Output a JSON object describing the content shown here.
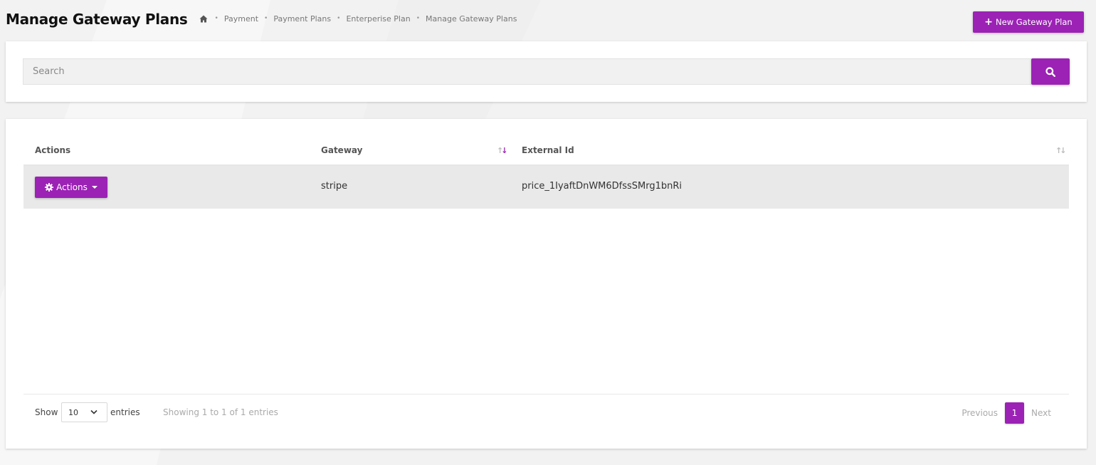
{
  "header": {
    "title": "Manage Gateway Plans",
    "new_button_label": "New Gateway Plan"
  },
  "breadcrumb": {
    "items": [
      "Payment",
      "Payment Plans",
      "Enterperise Plan",
      "Manage Gateway Plans"
    ]
  },
  "search": {
    "placeholder": "Search"
  },
  "table": {
    "columns": [
      "Actions",
      "Gateway",
      "External Id"
    ],
    "rows": [
      {
        "actions_label": "Actions",
        "gateway": "stripe",
        "external_id": "price_1IyaftDnWM6DfssSMrg1bnRi"
      }
    ]
  },
  "footer": {
    "show_label": "Show",
    "page_length": "10",
    "entries_label": "entries",
    "info": "Showing 1 to 1 of 1 entries",
    "prev_label": "Previous",
    "current_page": "1",
    "next_label": "Next"
  },
  "colors": {
    "accent": "#9b22b5",
    "background": "#f2f2f2"
  }
}
